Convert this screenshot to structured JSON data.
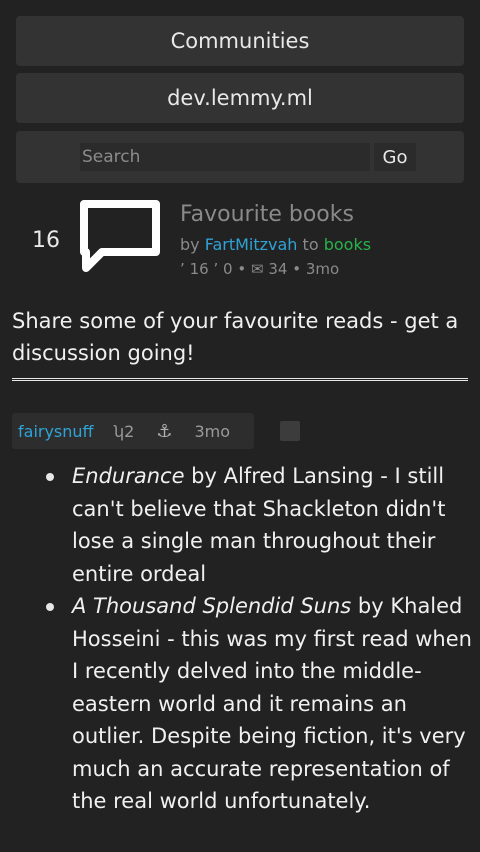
{
  "nav": {
    "communities_label": "Communities",
    "instance_label": "dev.lemmy.ml"
  },
  "search": {
    "placeholder": "Search",
    "go_label": "Go"
  },
  "post": {
    "score": "16",
    "thumbnail_icon": "comment-bubble-icon",
    "title": "Favourite books",
    "by_prefix": "by",
    "author": "FartMitzvah",
    "to_word": "to",
    "community": "books",
    "upvote_glyph": "ʼ",
    "upvotes": "16",
    "downvote_glyph": "ʼ",
    "downvotes": "0",
    "separator": "•",
    "comments_icon": "envelope-icon",
    "comments_glyph": "✉",
    "comment_count": "34",
    "age": "3mo",
    "body": "Share some of your favourite reads - get a discussion going!"
  },
  "comment": {
    "author": "fairysnuff",
    "score": "ʮ2",
    "anchor_icon": "anchor-icon",
    "anchor_glyph": "⚓",
    "age": "3mo",
    "items": [
      {
        "title": "Endurance",
        "text": " by Alfred Lansing - I still can't believe that Shackleton didn't lose a single man throughout their entire ordeal"
      },
      {
        "title": "A Thousand Splendid Suns",
        "text": " by Khaled Hosseini - this was my first read when I recently delved into the middle-eastern world and it remains an outlier. Despite being fiction, it's very much an accurate representation of the real world unfortunately."
      }
    ]
  },
  "colors": {
    "background": "#222222",
    "panel": "#333333",
    "link_user": "#2fa3d6",
    "link_community": "#27b34a",
    "muted": "#8a8a8a"
  }
}
